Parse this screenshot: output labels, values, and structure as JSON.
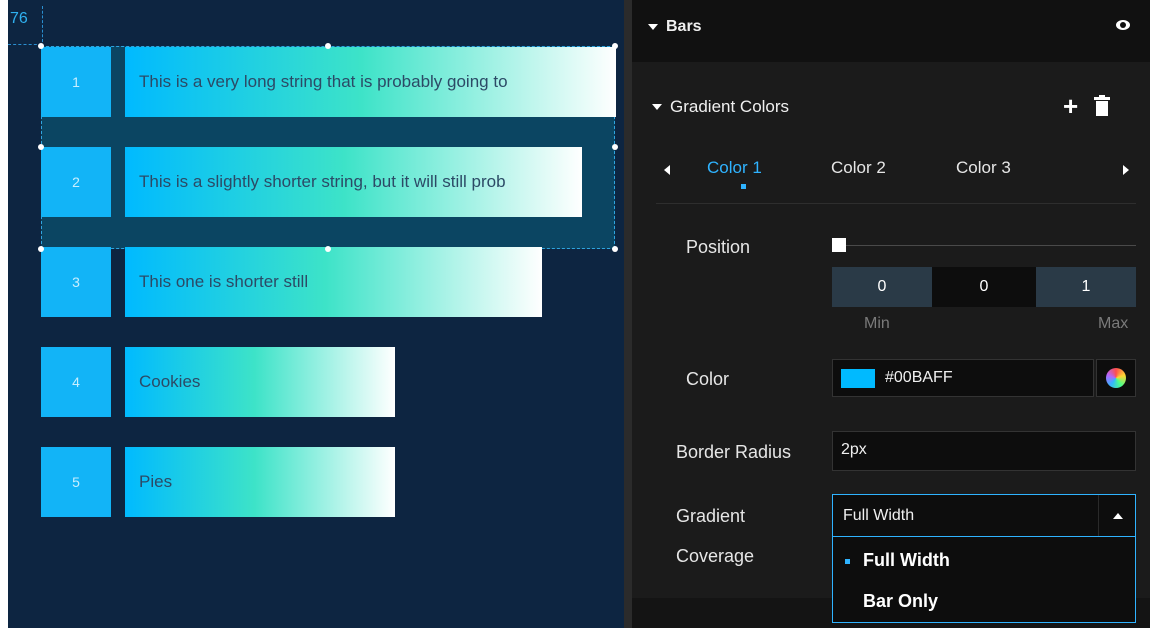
{
  "canvas": {
    "ruler_value": "76",
    "rows": [
      {
        "index": "1",
        "label": "This is a very long string that is probably going to",
        "value": 1.0
      },
      {
        "index": "2",
        "label": "This is a slightly shorter string, but it will still prob",
        "value": 0.93
      },
      {
        "index": "3",
        "label": "This one is shorter still",
        "value": 0.85
      },
      {
        "index": "4",
        "label": "Cookies",
        "value": 0.55
      },
      {
        "index": "5",
        "label": "Pies",
        "value": 0.55
      }
    ],
    "colors": {
      "background": "#0d2541",
      "selection": "#0b4562",
      "index_box": "#12b4f7",
      "gradient_start": "#00BAFF",
      "gradient_mid": "#3de3c8",
      "gradient_end": "#ffffff"
    }
  },
  "panel": {
    "bars_title": "Bars",
    "bars_visibility_icon": "eye-icon",
    "gradient_title": "Gradient Colors",
    "add_icon": "plus-icon",
    "delete_icon": "trash-icon",
    "tabs": [
      {
        "label": "Color 1",
        "active": true
      },
      {
        "label": "Color 2",
        "active": false
      },
      {
        "label": "Color 3",
        "active": false
      }
    ],
    "position": {
      "label": "Position",
      "slider_value": 0,
      "inputs": [
        "0",
        "0",
        "1"
      ],
      "min_label": "Min",
      "max_label": "Max"
    },
    "color": {
      "label": "Color",
      "value": "#00BAFF",
      "picker_icon": "color-wheel-icon"
    },
    "border_radius": {
      "label": "Border Radius",
      "value": "2px"
    },
    "gradient_coverage": {
      "label_line1": "Gradient",
      "label_line2": "Coverage",
      "selected": "Full Width",
      "options": [
        "Full Width",
        "Bar Only"
      ]
    },
    "accent_color": "#2fb3ff"
  }
}
